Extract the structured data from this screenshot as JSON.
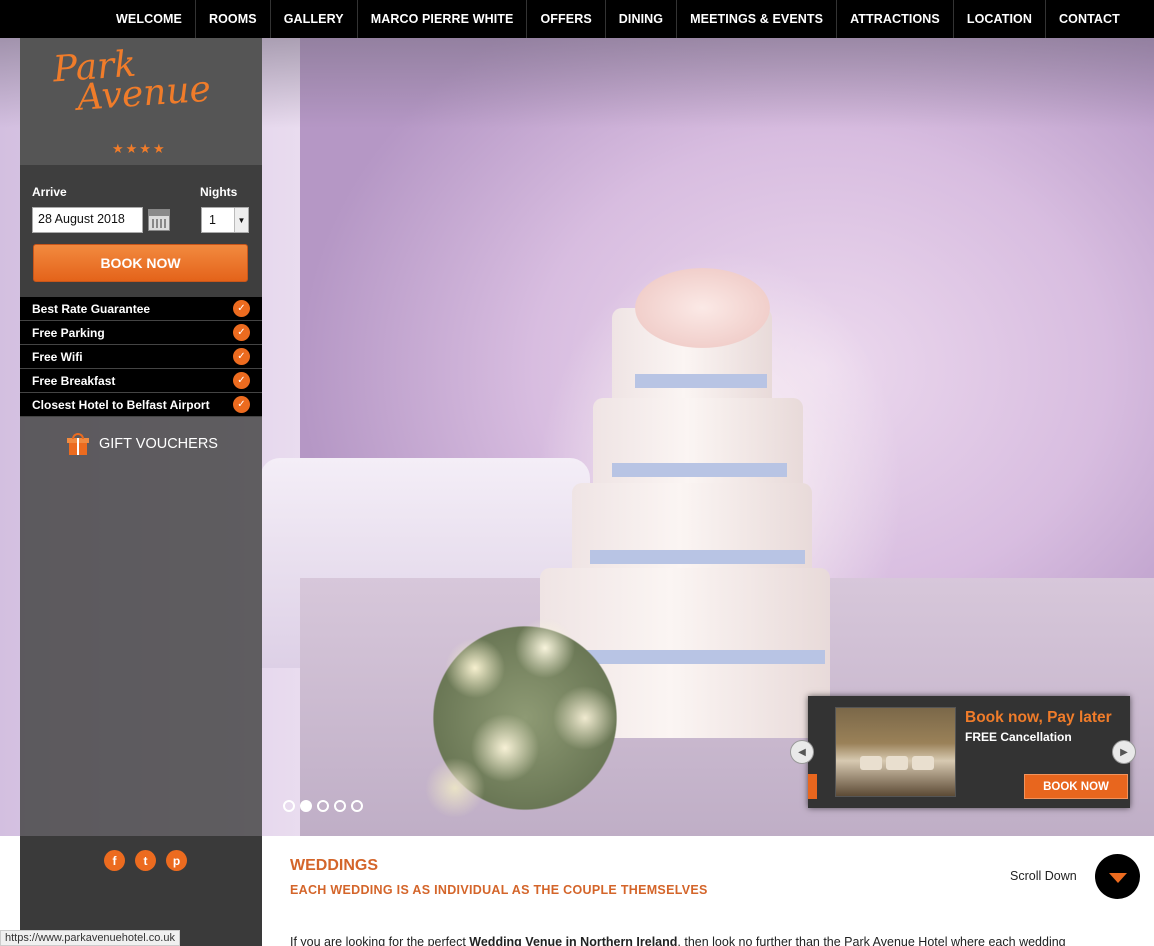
{
  "nav": {
    "items": [
      "WELCOME",
      "ROOMS",
      "GALLERY",
      "MARCO PIERRE WHITE",
      "OFFERS",
      "DINING",
      "MEETINGS & EVENTS",
      "ATTRACTIONS",
      "LOCATION",
      "CONTACT"
    ]
  },
  "logo": {
    "line1": "Park",
    "line2": "Avenue",
    "stars": "★★★★"
  },
  "booking": {
    "arrive_label": "Arrive",
    "arrive_value": "28 August 2018",
    "nights_label": "Nights",
    "nights_value": "1",
    "book_label": "BOOK NOW"
  },
  "features": [
    "Best Rate Guarantee",
    "Free Parking",
    "Free Wifi",
    "Free Breakfast",
    "Closest Hotel to Belfast Airport"
  ],
  "gift": {
    "label": "GIFT VOUCHERS"
  },
  "promo": {
    "title": "Book now, Pay later",
    "subtitle": "FREE Cancellation",
    "button": "BOOK NOW"
  },
  "slider": {
    "count": 5,
    "active": 1
  },
  "content": {
    "heading": "WEDDINGS",
    "subheading": "EACH WEDDING IS AS INDIVIDUAL AS THE COUPLE THEMSELVES",
    "scroll_label": "Scroll Down",
    "paragraph_start": "If you are looking for the perfect ",
    "paragraph_bold": "Wedding Venue in Northern Ireland",
    "paragraph_end": ", then look no further than the Park Avenue Hotel where each wedding"
  },
  "status_url": "https://www.parkavenuehotel.co.uk",
  "colors": {
    "accent": "#ec6b1f",
    "heading": "#d4652a"
  }
}
